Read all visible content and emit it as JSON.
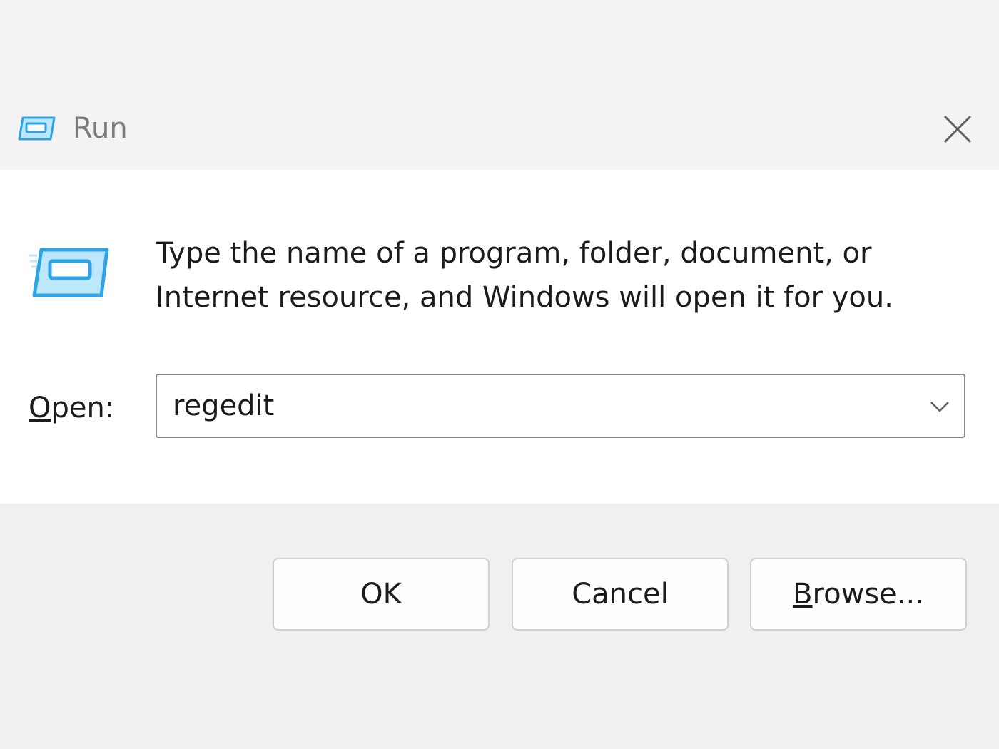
{
  "window": {
    "title": "Run",
    "title_icon": "run-icon",
    "close_icon": "close-icon"
  },
  "content": {
    "icon": "run-icon",
    "description": "Type the name of a program, folder, document, or Internet resource, and Windows will open it for you.",
    "open_label_mnemonic": "O",
    "open_label_rest": "pen:",
    "open_value": "regedit",
    "dropdown_icon": "chevron-down-icon"
  },
  "buttons": {
    "ok": "OK",
    "cancel": "Cancel",
    "browse_mnemonic": "B",
    "browse_rest": "rowse..."
  },
  "colors": {
    "icon_accent": "#2fa3e6",
    "icon_light": "#bde7fb"
  }
}
